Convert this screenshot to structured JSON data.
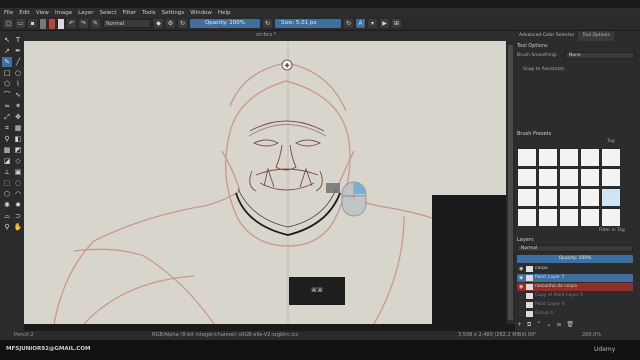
{
  "menu": [
    "File",
    "Edit",
    "View",
    "Image",
    "Layer",
    "Select",
    "Filter",
    "Tools",
    "Settings",
    "Window",
    "Help"
  ],
  "toolbar": {
    "blend_mode": "Normal",
    "opacity_label": "Opacity: 100%",
    "size_label": "Size: 5.01 px"
  },
  "document": {
    "tab_name": "orcbra *"
  },
  "canvas_overlay": {
    "key_label": "⌘⌘"
  },
  "status": {
    "tool": "Pencil-2",
    "color_profile": "RGB/Alpha (8-bit integer/channel)  sRGB-elle-V2-srgbtrc.icc",
    "dimensions": "3,508 x 2,480 (282.2 MiB)",
    "rotation": "0.00°",
    "zoom": "200.0%"
  },
  "right_panel": {
    "tabs": [
      "Advanced Color Selector",
      "Tool Options"
    ],
    "tool_options_title": "Tool Options",
    "brush_smoothing_label": "Brush Smoothing:",
    "brush_smoothing_value": "None",
    "snap_label": "Snap to Assistants",
    "brush_presets_title": "Brush Presets",
    "tag_label": "Tag",
    "filter_label": "Filter in Tag",
    "layers_title": "Layers",
    "layers_blend": "Normal",
    "layers_opacity": "Opacity: 100%",
    "layers": [
      {
        "name": "corpo",
        "style": "normal"
      },
      {
        "name": "Paint Layer 7",
        "style": "sel"
      },
      {
        "name": "rascunho do corpo",
        "style": "red"
      },
      {
        "name": "Copy of Paint Layer 5",
        "style": "dim"
      },
      {
        "name": "Paint Layer 4",
        "style": "dim"
      },
      {
        "name": "Group 4",
        "style": "dim"
      }
    ]
  },
  "watermark": "MFSJUNIOR92@GMAIL.COM",
  "branding": "Udemy"
}
